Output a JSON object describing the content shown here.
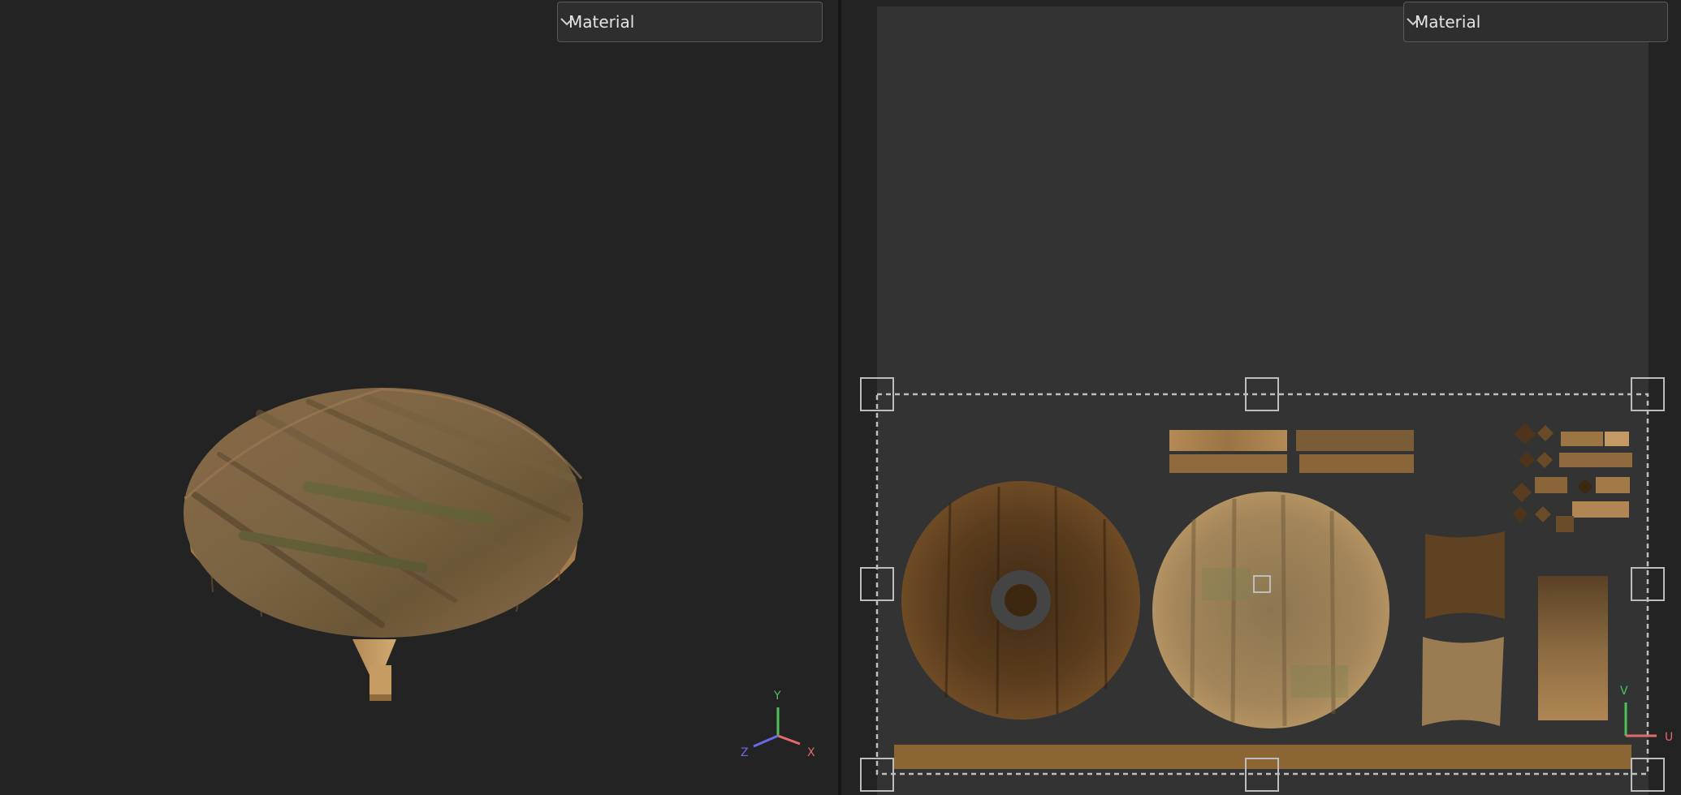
{
  "viewport_3d": {
    "material_dropdown": {
      "selected": "Material"
    },
    "axis_gizmo": {
      "y_label": "Y",
      "x_label": "X",
      "z_label": "Z",
      "y_color": "#4cc35a",
      "x_color": "#e06b6b",
      "z_color": "#6a6ae8"
    }
  },
  "uv_editor": {
    "material_dropdown": {
      "selected": "Material"
    },
    "uv_axes": {
      "u_label": "U",
      "v_label": "V",
      "u_color": "#e06b6b",
      "v_color": "#4cc35a"
    }
  },
  "colors": {
    "background": "#232323",
    "uv_canvas": "#333333",
    "wood_light": "#b58b58",
    "wood_dark": "#5b3d1e"
  }
}
